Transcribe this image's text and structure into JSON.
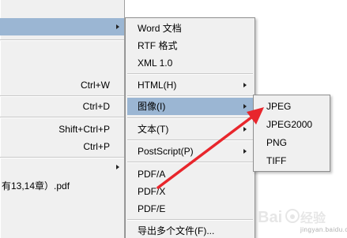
{
  "parent_menu": {
    "items": [
      {
        "shortcut": "",
        "has_submenu": true,
        "active": true
      },
      {
        "shortcut": "Ctrl+W"
      },
      {
        "shortcut": "Ctrl+D"
      },
      {
        "shortcut": "Shift+Ctrl+P"
      },
      {
        "shortcut": "Ctrl+P"
      },
      {
        "shortcut": "",
        "has_submenu": true
      },
      {
        "label": "有13,14章）.pdf"
      }
    ]
  },
  "save_as_menu": {
    "items": [
      {
        "label": "Word 文档"
      },
      {
        "label": "RTF 格式"
      },
      {
        "label": "XML 1.0"
      },
      {
        "label": "HTML(H)",
        "has_submenu": true
      },
      {
        "label": "图像(I)",
        "has_submenu": true,
        "active": true
      },
      {
        "label": "文本(T)",
        "has_submenu": true
      },
      {
        "label": "PostScript(P)",
        "has_submenu": true
      },
      {
        "label": "PDF/A"
      },
      {
        "label": "PDF/X"
      },
      {
        "label": "PDF/E"
      },
      {
        "label": "导出多个文件(F)..."
      }
    ]
  },
  "image_menu": {
    "items": [
      {
        "label": "JPEG"
      },
      {
        "label": "JPEG2000"
      },
      {
        "label": "PNG"
      },
      {
        "label": "TIFF"
      }
    ]
  },
  "annotation": {
    "color": "#e8262c",
    "points_to": "JPEG"
  },
  "watermark": {
    "text": "Baidu 经验",
    "sub": "jingyan.baidu.com"
  },
  "colors": {
    "menu_bg": "#f0f0f0",
    "highlight": "#9bb6d3",
    "border": "#8f8f8f"
  }
}
